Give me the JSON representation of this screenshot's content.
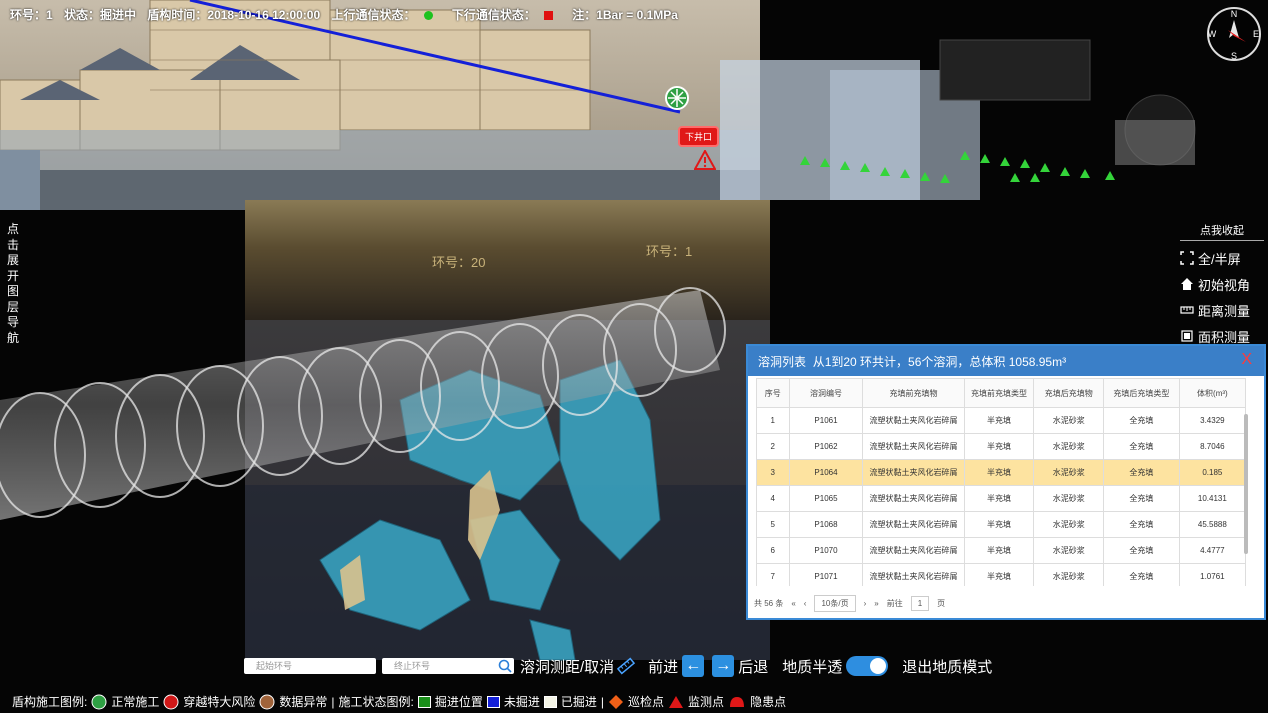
{
  "status": {
    "ring_label": "环号：1",
    "state_label": "状态：掘进中",
    "time_label": "盾构时间：2018-10-16 12:00:00",
    "uplink_label": "上行通信状态：",
    "uplink_color": "#1ec21e",
    "downlink_label": "下行通信状态：",
    "downlink_color": "#e01010",
    "note_label": "注：1Bar = 0.1MPa"
  },
  "compass": {
    "n": "N",
    "s": "S",
    "w": "W",
    "e": "E"
  },
  "scene": {
    "shaft_tag": "下井口",
    "ring_20": "环号：20",
    "ring_1": "环号：1"
  },
  "layer_nav": "点击展开图层导航",
  "tools": {
    "collapse": "点我收起",
    "items": [
      "全/半屏",
      "初始视角",
      "距离测量",
      "面积测量"
    ]
  },
  "cave_panel": {
    "title": "溶洞列表",
    "summary": "从1到20 环共计，56个溶洞，总体积 1058.95m³",
    "close": "X",
    "columns": [
      "序号",
      "溶洞编号",
      "充填前充填物",
      "充填前充填类型",
      "充填后充填物",
      "充填后充填类型",
      "体积(m³)"
    ],
    "rows": [
      [
        "1",
        "P1061",
        "流塑状黏土夹风化岩碎屑",
        "半充填",
        "水泥砂浆",
        "全充填",
        "3.4329"
      ],
      [
        "2",
        "P1062",
        "流塑状黏土夹风化岩碎屑",
        "半充填",
        "水泥砂浆",
        "全充填",
        "8.7046"
      ],
      [
        "3",
        "P1064",
        "流塑状黏土夹风化岩碎屑",
        "半充填",
        "水泥砂浆",
        "全充填",
        "0.185"
      ],
      [
        "4",
        "P1065",
        "流塑状黏土夹风化岩碎屑",
        "半充填",
        "水泥砂浆",
        "全充填",
        "10.4131"
      ],
      [
        "5",
        "P1068",
        "流塑状黏土夹风化岩碎屑",
        "半充填",
        "水泥砂浆",
        "全充填",
        "45.5888"
      ],
      [
        "6",
        "P1070",
        "流塑状黏土夹风化岩碎屑",
        "半充填",
        "水泥砂浆",
        "全充填",
        "4.4777"
      ],
      [
        "7",
        "P1071",
        "流塑状黏土夹风化岩碎屑",
        "半充填",
        "水泥砂浆",
        "全充填",
        "1.0761"
      ]
    ],
    "selected_row": 3,
    "pager": {
      "total": "共 56 条",
      "first": "«",
      "prev": "‹",
      "page_size": "10条/页",
      "next": "›",
      "last": "»",
      "goto": "前往",
      "page": "1",
      "unit": "页"
    }
  },
  "controls": {
    "start_placeholder": "起始环号",
    "end_placeholder": "终止环号",
    "cave_measure": "溶洞测距/取消",
    "forward": "前进",
    "backward": "后退",
    "geo_transparent": "地质半透",
    "exit_geo": "退出地质模式"
  },
  "legend": {
    "shield_title": "盾构施工图例:",
    "normal": "正常施工",
    "risk": "穿越特大风险",
    "abnormal": "数据异常",
    "sep1": "|",
    "state_title": "施工状态图例:",
    "pos": "掘进位置",
    "not_dug": "未掘进",
    "dug": "已掘进",
    "sep2": "|",
    "patrol": "巡检点",
    "monitor": "监测点",
    "hazard": "隐患点"
  }
}
